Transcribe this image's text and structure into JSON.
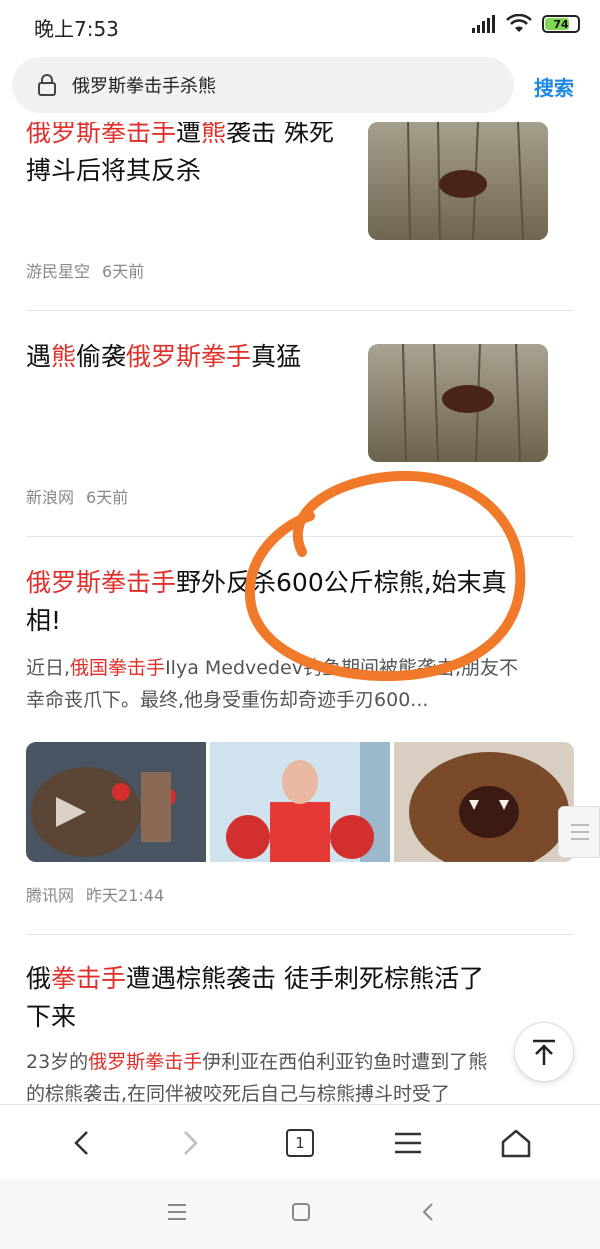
{
  "status": {
    "time": "晚上7:53",
    "battery": "74"
  },
  "search": {
    "query": "俄罗斯拳击手杀熊",
    "button": "搜索"
  },
  "articles": [
    {
      "title_parts": [
        {
          "t": "俄罗斯拳击手",
          "hl": true
        },
        {
          "t": "遭",
          "hl": false
        },
        {
          "t": "熊",
          "hl": true
        },
        {
          "t": "袭击 殊死",
          "hl": false
        }
      ],
      "title_line2": "搏斗后将其反杀",
      "source": "游民星空",
      "time": "6天前"
    },
    {
      "title_parts": [
        {
          "t": "遇",
          "hl": false
        },
        {
          "t": "熊",
          "hl": true
        },
        {
          "t": "偷袭",
          "hl": false
        },
        {
          "t": "俄罗斯拳手",
          "hl": true
        },
        {
          "t": "真猛",
          "hl": false
        }
      ],
      "source": "新浪网",
      "time": "6天前"
    },
    {
      "title_parts": [
        {
          "t": "俄罗斯拳击手",
          "hl": true
        },
        {
          "t": "野外反杀600公斤棕熊,始末真",
          "hl": false
        }
      ],
      "title_line2": "相!",
      "snippet_parts": [
        {
          "t": "近日,",
          "hl": false
        },
        {
          "t": "俄国拳击手",
          "hl": true
        },
        {
          "t": "Ilya Medvedev钓鱼期间被熊袭击,朋友不",
          "hl": false
        }
      ],
      "snippet_line2": "幸命丧爪下。最终,他身受重伤却奇迹手刃600...",
      "source": "腾讯网",
      "time": "昨天21:44"
    },
    {
      "title_parts": [
        {
          "t": "俄",
          "hl": false
        },
        {
          "t": "拳击手",
          "hl": true
        },
        {
          "t": "遭遇棕熊袭击 徒手刺死棕熊活了",
          "hl": false
        }
      ],
      "title_line2": "下来",
      "snippet_parts": [
        {
          "t": "23岁的",
          "hl": false
        },
        {
          "t": "俄罗斯拳击手",
          "hl": true
        },
        {
          "t": "伊利亚在西伯利亚钓鱼时遭到了熊",
          "hl": false
        }
      ],
      "snippet_line2": "的棕熊袭击,在同伴被咬死后自己与棕熊搏斗时受了"
    }
  ],
  "toolbar": {
    "tab_count": "1"
  },
  "icons": [
    "lock-icon",
    "signal-icon",
    "wifi-icon",
    "battery-icon",
    "back-arrow-icon",
    "forward-arrow-icon",
    "tabs-icon",
    "menu-icon",
    "home-icon",
    "back-to-top-icon"
  ],
  "colors": {
    "highlight": "#e0302b",
    "accent": "#1e88e5",
    "annotation": "#f07a2a"
  }
}
